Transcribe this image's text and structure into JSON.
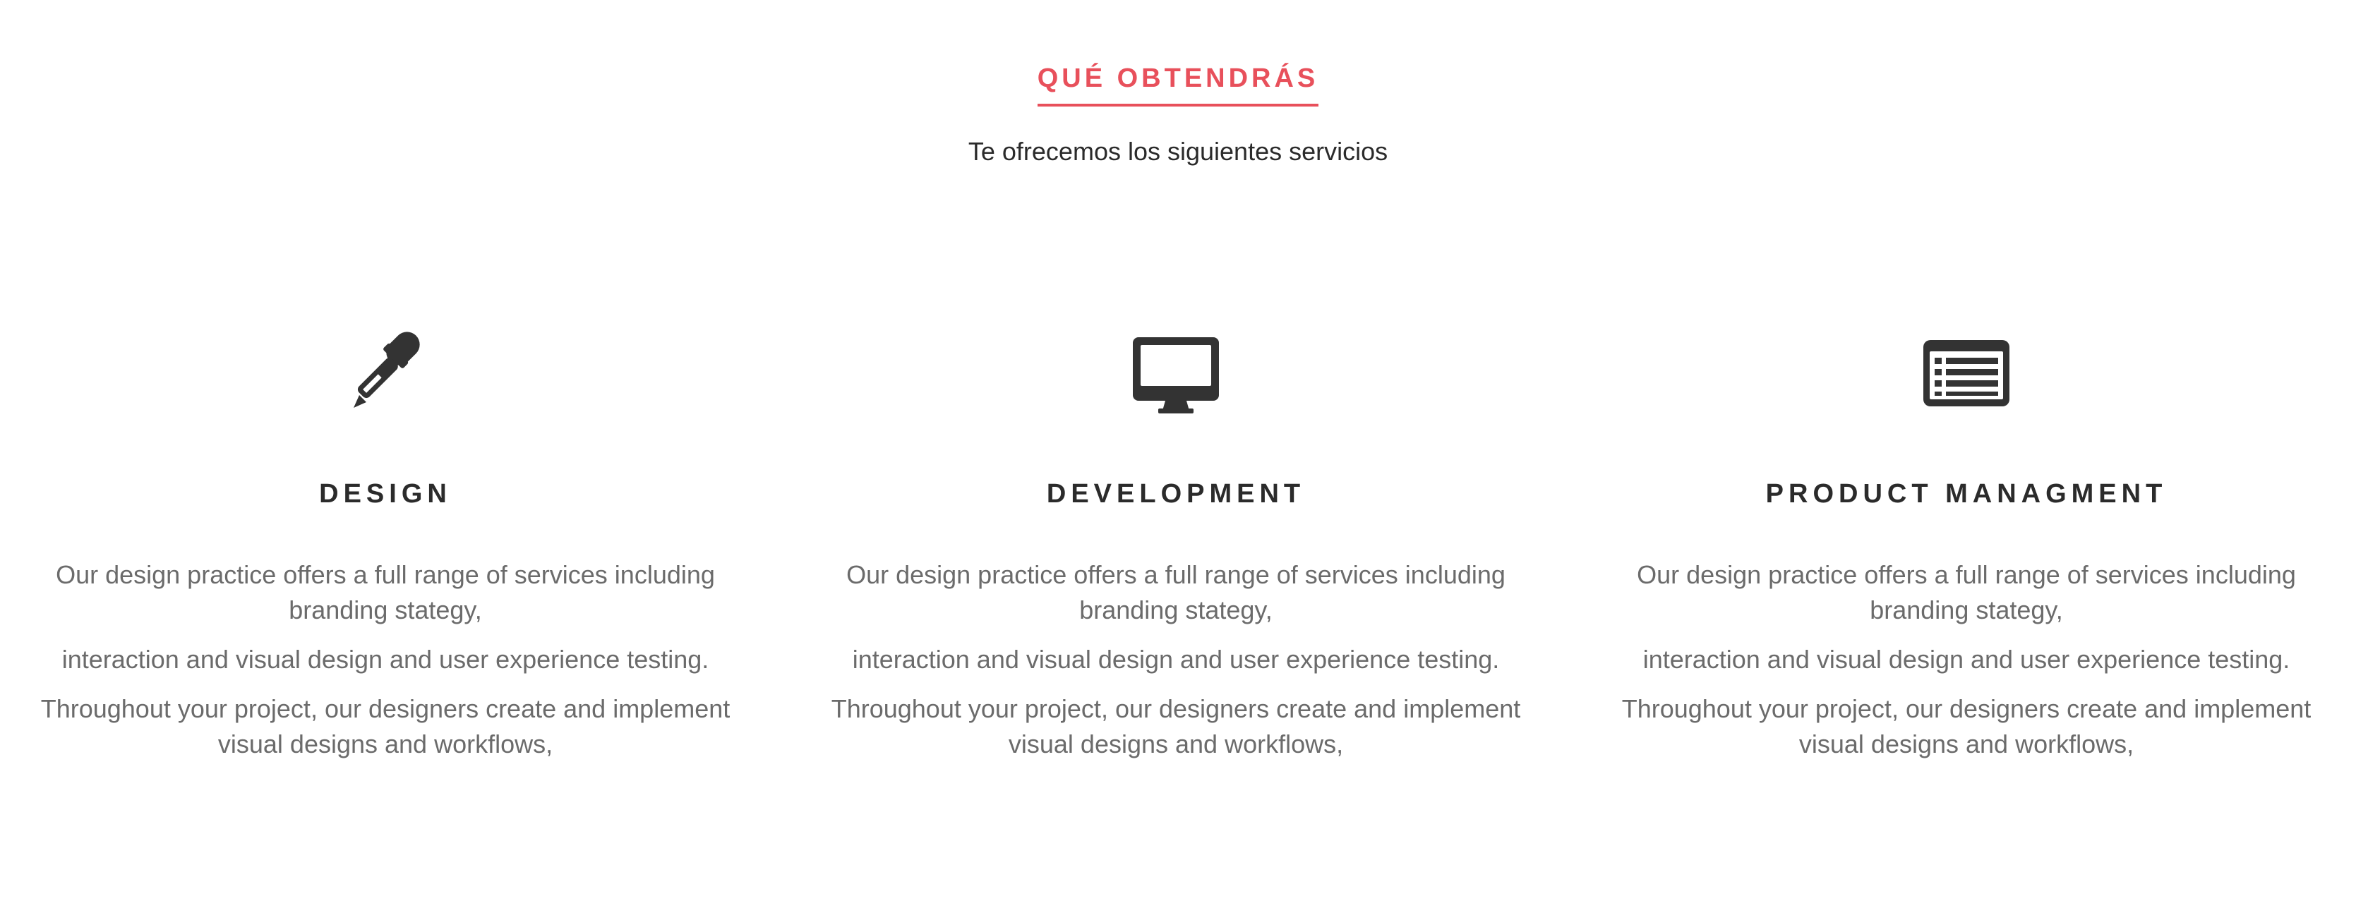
{
  "header": {
    "eyebrow": "QUÉ OBTENDRÁS",
    "subtitle": "Te ofrecemos los siguientes servicios"
  },
  "colors": {
    "accent": "#e8505b",
    "heading": "#2b2b2b",
    "body_text": "#6b6b6b",
    "icon": "#333333"
  },
  "services": [
    {
      "icon": "eyedropper-icon",
      "title": "DESIGN",
      "lines": [
        "Our design practice offers a full range of services including branding stategy,",
        "interaction and visual design and user experience testing.",
        "Throughout your project, our designers create and implement visual designs and workflows,"
      ]
    },
    {
      "icon": "desktop-icon",
      "title": "DEVELOPMENT",
      "lines": [
        "Our design practice offers a full range of services including branding stategy,",
        "interaction and visual design and user experience testing.",
        "Throughout your project, our designers create and implement visual designs and workflows,"
      ]
    },
    {
      "icon": "list-alt-icon",
      "title": "PRODUCT MANAGMENT",
      "lines": [
        "Our design practice offers a full range of services including branding stategy,",
        "interaction and visual design and user experience testing.",
        "Throughout your project, our designers create and implement visual designs and workflows,"
      ]
    }
  ]
}
